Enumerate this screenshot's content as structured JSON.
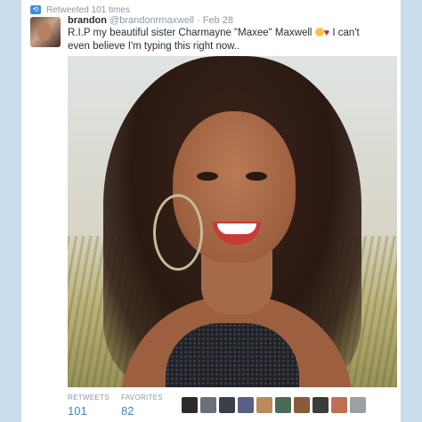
{
  "retweet_banner": {
    "text": "Retweeted 101 times"
  },
  "tweet": {
    "name": "brandon",
    "handle": "@brandonrmaxwell",
    "separator": "·",
    "date": "Feb 28",
    "text_before": "R.I.P my beautiful sister Charmayne \"Maxee\" Maxwell",
    "text_after": " I can't even believe I'm typing this right now.."
  },
  "stats": {
    "retweets_label": "RETWEETS",
    "retweets_count": "101",
    "favorites_label": "FAVORITES",
    "favorites_count": "82"
  },
  "favoriters": [
    {
      "color": "#2b2b2b"
    },
    {
      "color": "#6b6f78"
    },
    {
      "color": "#3a3f4a"
    },
    {
      "color": "#5a5f8a"
    },
    {
      "color": "#b98a5a"
    },
    {
      "color": "#4a6a5a"
    },
    {
      "color": "#8a5a3a"
    },
    {
      "color": "#3b3b3b"
    },
    {
      "color": "#c07050"
    },
    {
      "color": "#9aa0a6"
    }
  ],
  "colors": {
    "link": "#3b88c3",
    "muted": "#8899a6",
    "text": "#292f33",
    "page_bg": "#c9dded"
  }
}
